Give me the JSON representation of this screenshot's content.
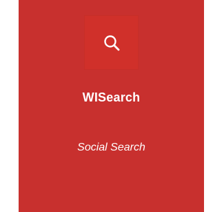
{
  "tile": {
    "icon": "search-icon",
    "title": "WISearch",
    "subtitle": "Social Search",
    "colors": {
      "background": "#c8302e",
      "icon_box": "#d0302a",
      "text": "#ffffff"
    }
  }
}
